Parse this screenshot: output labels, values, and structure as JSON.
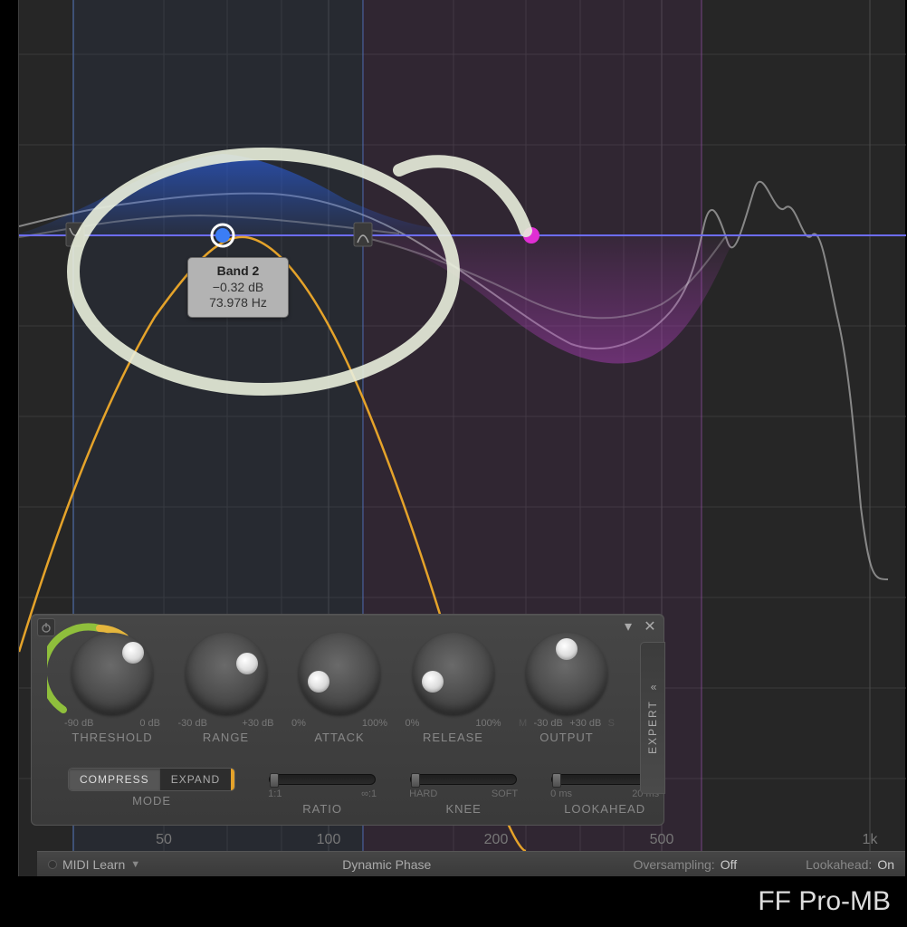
{
  "product_name": "FF Pro-MB",
  "tooltip": {
    "title": "Band 2",
    "db": "−0.32 dB",
    "hz": "73.978 Hz"
  },
  "colors": {
    "band2": "#3b7df5",
    "band3": "#c146c9",
    "node_pink": "#e02ed4",
    "accent_yellow": "#e5a32a",
    "threshold_arc_green": "#8fbf3c",
    "threshold_arc_yellow": "#e5b63d"
  },
  "freq_axis_labels": [
    "50",
    "100",
    "200",
    "500",
    "1k"
  ],
  "panel": {
    "knobs": [
      {
        "key": "threshold",
        "label": "THRESHOLD",
        "min": "-90 dB",
        "max": "0 dB"
      },
      {
        "key": "range",
        "label": "RANGE",
        "min": "-30 dB",
        "max": "+30 dB"
      },
      {
        "key": "attack",
        "label": "ATTACK",
        "min": "0%",
        "max": "100%"
      },
      {
        "key": "release",
        "label": "RELEASE",
        "min": "0%",
        "max": "100%"
      },
      {
        "key": "output",
        "label": "OUTPUT",
        "min": "-30 dB",
        "max": "+30 dB"
      }
    ],
    "mode": {
      "label": "MODE",
      "options": [
        "COMPRESS",
        "EXPAND"
      ],
      "active": "COMPRESS"
    },
    "ratio": {
      "label": "RATIO",
      "min": "1:1",
      "max": "∞:1"
    },
    "knee": {
      "label": "KNEE",
      "min": "HARD",
      "max": "SOFT"
    },
    "lookahead": {
      "label": "LOOKAHEAD",
      "min": "0 ms",
      "max": "20 ms"
    },
    "output_side_labels": {
      "left": "M",
      "right": "S"
    },
    "expert": "EXPERT"
  },
  "footer": {
    "midi_learn": "MIDI Learn",
    "phase_mode": "Dynamic Phase",
    "oversampling_label": "Oversampling:",
    "oversampling_value": "Off",
    "lookahead_label": "Lookahead:",
    "lookahead_value": "On"
  }
}
